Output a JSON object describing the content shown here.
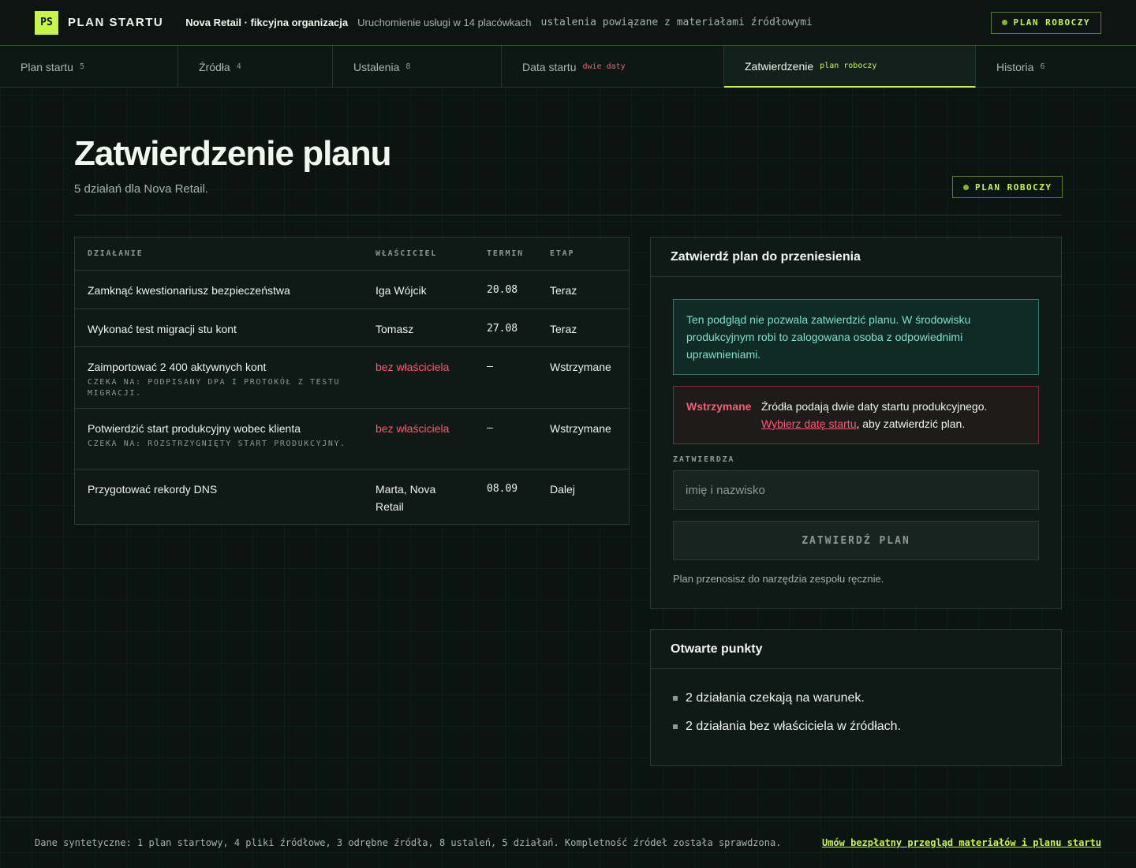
{
  "header": {
    "logo": "PS",
    "brand": "PLAN STARTU",
    "org": "Nova Retail · fikcyjna organizacja",
    "description": "Uruchomienie usługi w 14 placówkach",
    "note": "ustalenia powiązane z materiałami źródłowymi",
    "status": "PLAN ROBOCZY"
  },
  "tabs": [
    {
      "label": "Plan startu",
      "count": "5"
    },
    {
      "label": "Źródła",
      "count": "4"
    },
    {
      "label": "Ustalenia",
      "count": "8"
    },
    {
      "label": "Data startu",
      "flag": "dwie daty"
    },
    {
      "label": "Zatwierdzenie",
      "flag": "plan roboczy"
    },
    {
      "label": "Historia",
      "count": "6"
    }
  ],
  "page": {
    "title": "Zatwierdzenie planu",
    "subtitle": "5 działań dla Nova Retail.",
    "status": "PLAN ROBOCZY"
  },
  "table": {
    "headers": [
      "DZIAŁANIE",
      "WŁAŚCICIEL",
      "TERMIN",
      "ETAP"
    ],
    "rows": [
      {
        "action": "Zamknąć kwestionariusz bezpieczeństwa",
        "wait": "",
        "owner": "Iga Wójcik",
        "due": "20.08",
        "stage": "Teraz"
      },
      {
        "action": "Wykonać test migracji stu kont",
        "wait": "",
        "owner": "Tomasz",
        "due": "27.08",
        "stage": "Teraz"
      },
      {
        "action": "Zaimportować 2 400 aktywnych kont",
        "wait": "Czeka na: podpisany DPA i protokół z testu migracji.",
        "owner": "bez właściciela",
        "due": "–",
        "stage": "Wstrzymane"
      },
      {
        "action": "Potwierdzić start produkcyjny wobec klienta",
        "wait": "Czeka na: rozstrzygnięty start produkcyjny.",
        "owner": "bez właściciela",
        "due": "–",
        "stage": "Wstrzymane"
      },
      {
        "action": "Przygotować rekordy DNS",
        "wait": "",
        "owner": "Marta, Nova Retail",
        "due": "08.09",
        "stage": "Dalej"
      }
    ]
  },
  "approve": {
    "title": "Zatwierdź plan do przeniesienia",
    "info": "Ten podgląd nie pozwala zatwierdzić planu. W środowisku produkcyjnym robi to zalogowana osoba z odpowiednimi uprawnieniami.",
    "warn_label": "Wstrzymane",
    "warn_text": "Źródła podają dwie daty startu produkcyjnego.",
    "warn_link": "Wybierz datę startu",
    "warn_suffix": ", aby zatwierdzić plan.",
    "field_label": "ZATWIERDZA",
    "field_placeholder": "imię i nazwisko",
    "button": "ZATWIERDŹ PLAN",
    "footnote": "Plan przenosisz do narzędzia zespołu ręcznie."
  },
  "open_points": {
    "title": "Otwarte punkty",
    "items": [
      "2 działania czekają na warunek.",
      "2 działania bez właściciela w źródłach."
    ]
  },
  "footer": {
    "text": "Dane syntetyczne: 1 plan startowy, 4 pliki źródłowe, 3 odrębne źródła, 8 ustaleń, 5 działań. Kompletność źródeł została sprawdzona.",
    "link": "Umów bezpłatny przegląd materiałów i planu startu"
  },
  "colors": {
    "accent": "#c8f54a",
    "danger": "#ff5a72",
    "info": "#7fe0cf"
  }
}
